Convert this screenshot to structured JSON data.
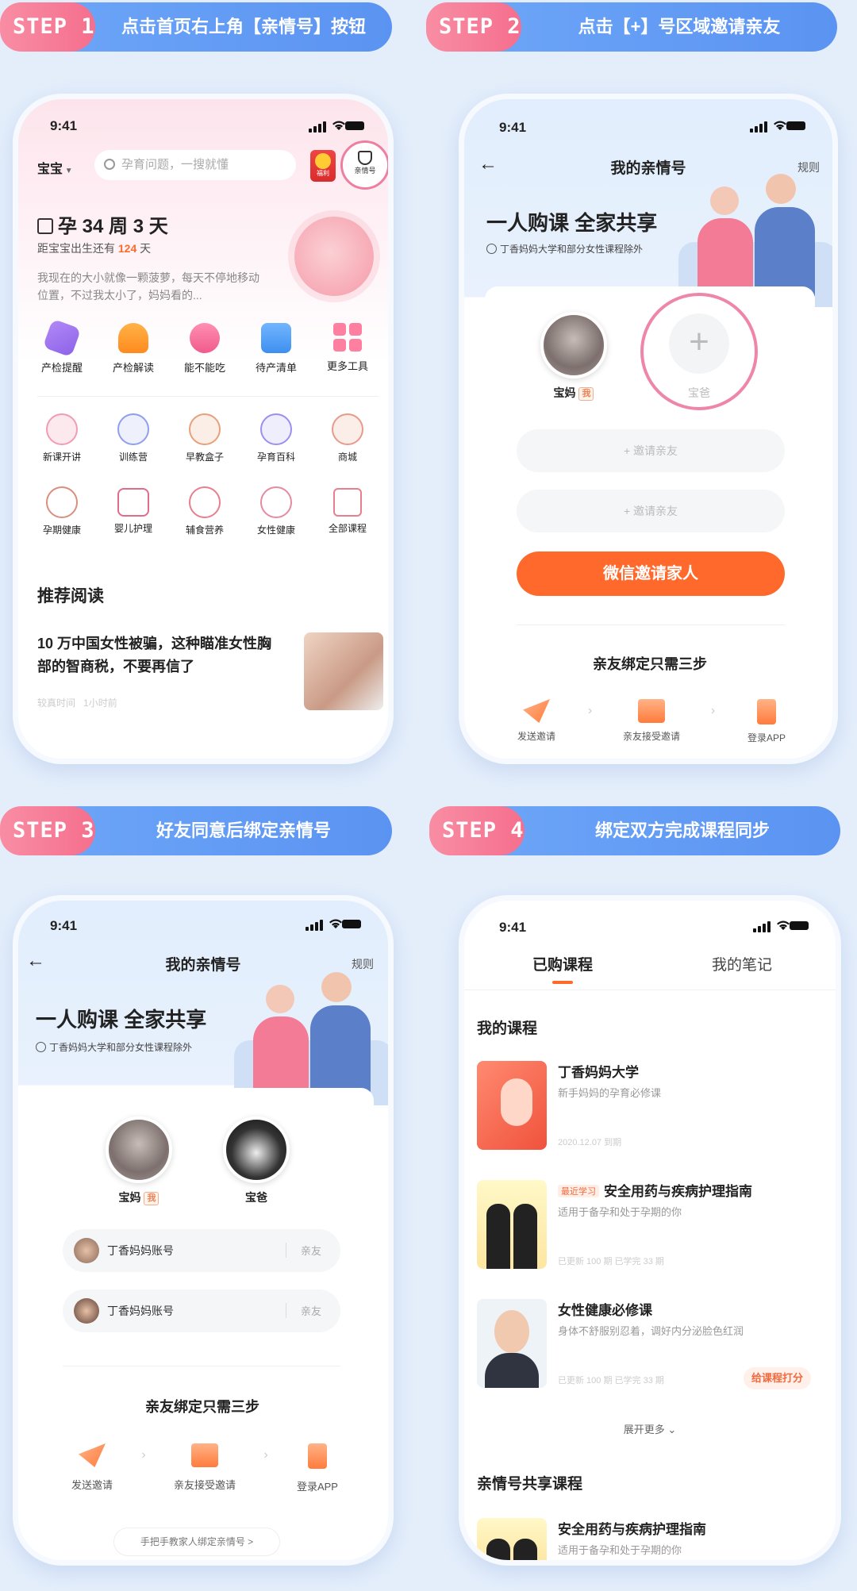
{
  "banners": [
    {
      "step": "STEP 1",
      "text": "点击首页右上角【亲情号】按钮"
    },
    {
      "step": "STEP 2",
      "text": "点击【+】号区域邀请亲友"
    },
    {
      "step": "STEP 3",
      "text": "好友同意后绑定亲情号"
    },
    {
      "step": "STEP 4",
      "text": "绑定双方完成课程同步"
    }
  ],
  "status_time": "9:41",
  "p1": {
    "baby_selector": "宝宝",
    "search_placeholder": "孕育问题，一搜就懂",
    "fortune_label": "福利",
    "family_label": "亲情号",
    "week_title": "孕 34 周 3 天",
    "due_prefix": "距宝宝出生还有",
    "due_days": "124",
    "due_suffix": "天",
    "desc": "我现在的大小就像一颗菠萝，每天不停地移动位置，不过我太小了，妈妈看的...",
    "tools_row1": [
      "产检提醒",
      "产检解读",
      "能不能吃",
      "待产清单",
      "更多工具"
    ],
    "tools_row2": [
      "新课开讲",
      "训练营",
      "早教盒子",
      "孕育百科",
      "商城"
    ],
    "tools_row3": [
      "孕期健康",
      "婴儿护理",
      "辅食营养",
      "女性健康",
      "全部课程"
    ],
    "section": "推荐阅读",
    "article_title": "10 万中国女性被骗，这种瞄准女性胸部的智商税，不要再信了",
    "article_meta_a": "较真时间",
    "article_meta_b": "1小时前"
  },
  "p2": {
    "back": "←",
    "title": "我的亲情号",
    "rules": "规则",
    "headline": "一人购课 全家共享",
    "note": "丁香妈妈大学和部分女性课程除外",
    "member1": "宝妈",
    "member1_tag": "我",
    "member2": "宝爸",
    "plus": "+",
    "invite": "+ 邀请亲友",
    "wechat_btn": "微信邀请家人",
    "steps_title": "亲友绑定只需三步",
    "steps": [
      "发送邀请",
      "亲友接受邀请",
      "登录APP"
    ]
  },
  "p3": {
    "title": "我的亲情号",
    "rules": "规则",
    "headline": "一人购课 全家共享",
    "note": "丁香妈妈大学和部分女性课程除外",
    "member1": "宝妈",
    "member1_tag": "我",
    "member2": "宝爸",
    "accounts": [
      {
        "name": "丁香妈妈账号",
        "role": "亲友"
      },
      {
        "name": "丁香妈妈账号",
        "role": "亲友"
      }
    ],
    "steps_title": "亲友绑定只需三步",
    "steps": [
      "发送邀请",
      "亲友接受邀请",
      "登录APP"
    ],
    "guide": "手把手教家人绑定亲情号 >"
  },
  "p4": {
    "tab_active": "已购课程",
    "tab_other": "我的笔记",
    "my_courses": "我的课程",
    "courses": [
      {
        "title": "丁香妈妈大学",
        "sub": "新手妈妈的孕育必修课",
        "meta": "2020.12.07 到期",
        "tag": "",
        "action": ""
      },
      {
        "title": "安全用药与疾病护理指南",
        "sub": "适用于备孕和处于孕期的你",
        "meta": "已更新 100 期   已学完 33 期",
        "tag": "最近学习",
        "action": ""
      },
      {
        "title": "女性健康必修课",
        "sub": "身体不舒服别忍着，调好内分泌脸色红润",
        "meta": "已更新 100 期   已学完 33 期",
        "tag": "",
        "action": "给课程打分"
      }
    ],
    "expand": "展开更多",
    "shared": "亲情号共享课程",
    "shared_course_title": "安全用药与疾病护理指南",
    "shared_course_sub": "适用于备孕和处于孕期的你"
  },
  "colors": {
    "orange": "#ff6a2c",
    "pink": "#f56f8d",
    "blue": "#5b93f2"
  }
}
